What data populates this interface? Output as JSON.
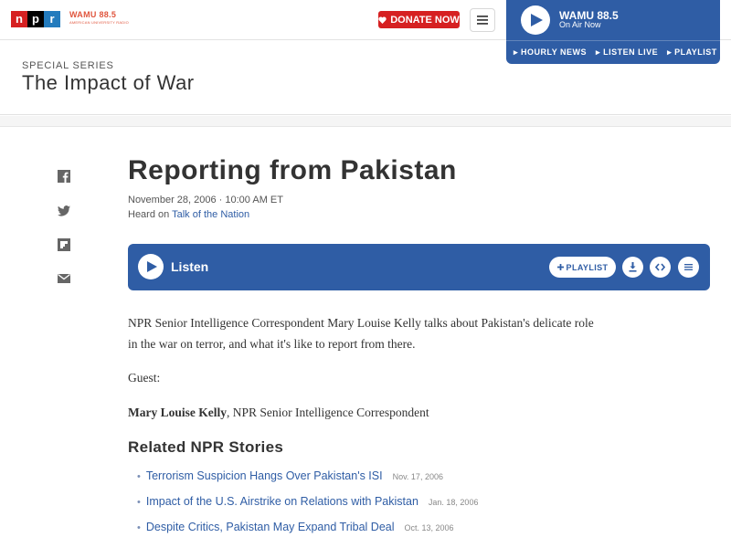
{
  "header": {
    "logo": [
      "n",
      "p",
      "r"
    ],
    "station_name": "WAMU 88.5",
    "station_tagline": "AMERICAN UNIVERSITY RADIO",
    "donate_label": "DONATE NOW",
    "colors": {
      "npr_red": "#d62021",
      "npr_blue": "#237bbd",
      "player_blue": "#2f5da5"
    }
  },
  "player": {
    "station": "WAMU 88.5",
    "status": "On Air Now",
    "links": [
      "HOURLY NEWS",
      "LISTEN LIVE",
      "PLAYLIST"
    ]
  },
  "series": {
    "eyebrow": "SPECIAL SERIES",
    "title": "The Impact of War"
  },
  "share_icons": [
    "facebook-icon",
    "twitter-icon",
    "flipboard-icon",
    "email-icon"
  ],
  "story": {
    "title": "Reporting from Pakistan",
    "dateline": "November 28, 2006 · 10:00 AM ET",
    "heard_prefix": "Heard on",
    "heard_program": "Talk of the Nation",
    "listen_label": "Listen",
    "playlist_label": "PLAYLIST",
    "paragraph1": "NPR Senior Intelligence Correspondent Mary Louise Kelly talks about Pakistan's delicate role in the war on terror, and what it's like to report from there.",
    "guest_label": "Guest:",
    "guest_name": "Mary Louise Kelly",
    "guest_role": ", NPR Senior Intelligence Correspondent"
  },
  "related": {
    "title": "Related NPR Stories",
    "items": [
      {
        "label": "Terrorism Suspicion Hangs Over Pakistan's ISI",
        "date": "Nov. 17, 2006"
      },
      {
        "label": "Impact of the U.S. Airstrike on Relations with Pakistan",
        "date": "Jan. 18, 2006"
      },
      {
        "label": "Despite Critics, Pakistan May Expand Tribal Deal",
        "date": "Oct. 13, 2006"
      }
    ]
  }
}
